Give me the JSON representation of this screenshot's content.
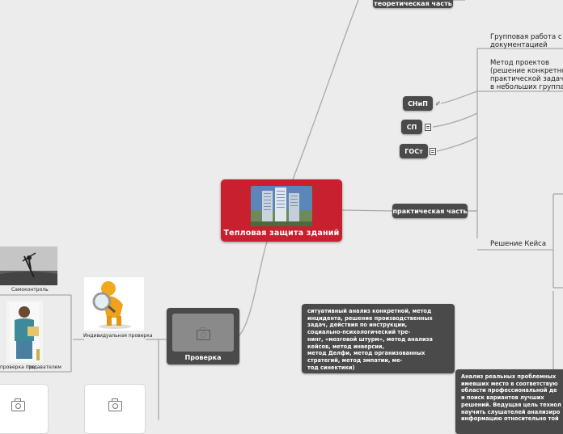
{
  "central": {
    "title": "Тепловая защита зданий",
    "image_icon": "building-photo"
  },
  "nodes": {
    "theory": "теоретическая часть",
    "practice": "практическая часть",
    "check": "Проверка",
    "snip": "СНиП",
    "sp": "СП",
    "gost": "ГОСт"
  },
  "texts": {
    "group_work": [
      "Групповая работа с н",
      "документацией"
    ],
    "project_method": [
      "Метод проектов",
      "(решение конкретной",
      "практической задачи",
      "в небольших группах"
    ],
    "case": "Решение Кейса"
  },
  "callouts": {
    "methods": "ситуативный анализ конкретной, метод\nинцидента, решение производственных\nзадач, действия по инструкции,\nсоциально-психологический тре-\nнинг, «мозговой штурм», метод анализа\nкейсов, метод инверсии,\nметод Делфи, метод организованных\nстратегий, метод эмпатии, ме-\nтод синектики)",
    "analysis": "Анализ реальных проблемных\nимевших место в соответствую\nобласти профессиональной де\nи поиск вариантов лучших\nрешений. Ведущая цель технол\nнаучить слушателей анализиро\nинформацию относительно той"
  },
  "check_labels": {
    "self_control": "Самоконтроль",
    "individual": "Индивидуальная проверка",
    "teacher_check": "проверка пре",
    "teacher_suffix": "подавателем"
  },
  "colors": {
    "central": "#c8202e",
    "node": "#4a4a4a",
    "line": "#a9a9a9",
    "background": "#ececec"
  }
}
